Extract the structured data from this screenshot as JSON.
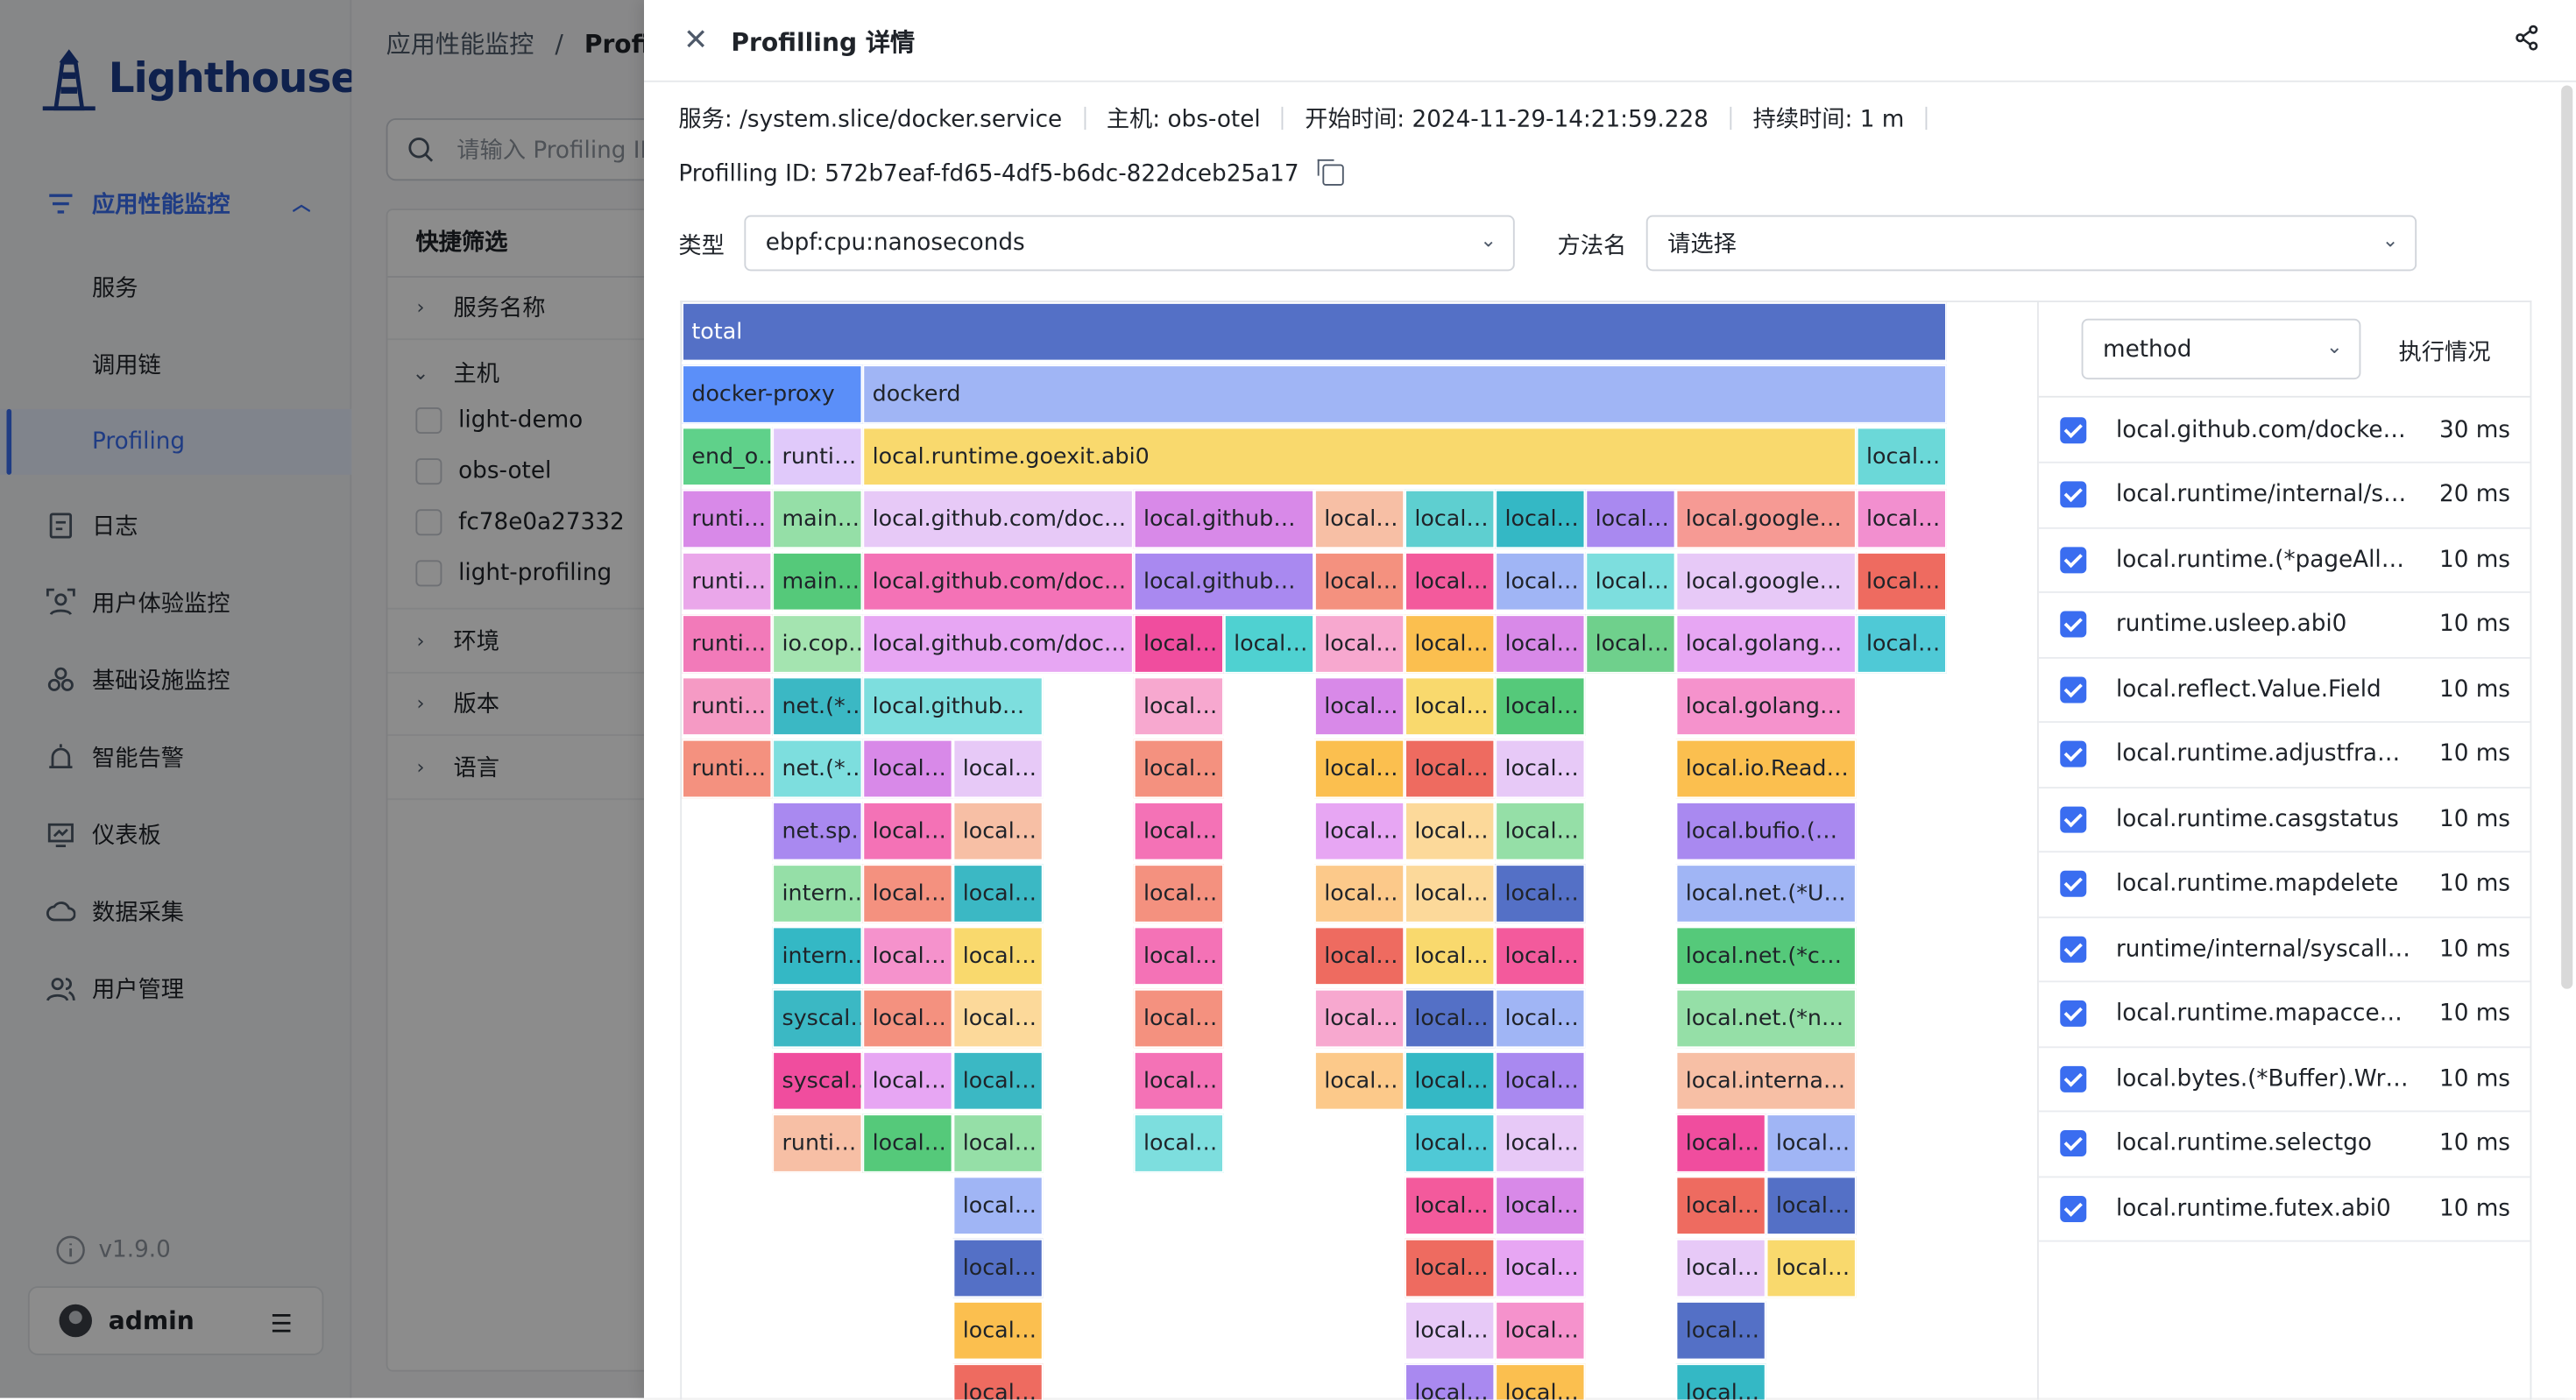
{
  "sidebar": {
    "brand": "Lighthouse",
    "nav": [
      {
        "label": "应用性能监控",
        "icon": "apm-icon"
      },
      {
        "label": "服务"
      },
      {
        "label": "调用链"
      },
      {
        "label": "Profiling"
      },
      {
        "label": "日志",
        "icon": "log-icon"
      },
      {
        "label": "用户体验监控",
        "icon": "user-exp-icon"
      },
      {
        "label": "基础设施监控",
        "icon": "infra-icon"
      },
      {
        "label": "智能告警",
        "icon": "alert-icon"
      },
      {
        "label": "仪表板",
        "icon": "dashboard-icon"
      },
      {
        "label": "数据采集",
        "icon": "collect-icon"
      },
      {
        "label": "用户管理",
        "icon": "user-mgmt-icon"
      }
    ],
    "version": "v1.9.0",
    "user": "admin"
  },
  "main": {
    "breadcrumb_root": "应用性能监控",
    "breadcrumb_sep": "/",
    "breadcrumb_current": "Profilin",
    "search_placeholder": "请输入 Profiling ID",
    "filter_title": "快捷筛选",
    "filters": [
      "服务名称",
      "主机",
      "环境",
      "版本",
      "语言"
    ],
    "host_options": [
      "light-demo",
      "obs-otel",
      "fc78e0a27332",
      "light-profiling"
    ]
  },
  "drawer": {
    "title": "Profilling 详情",
    "service": "服务: /system.slice/docker.service",
    "host": "主机: obs-otel",
    "start": "开始时间: 2024-11-29-14:21:59.228",
    "duration": "持续时间: 1 m",
    "profiling_id": "Profilling ID: 572b7eaf-fd65-4df5-b6dc-822dceb25a17",
    "type_label": "类型",
    "type_value": "ebpf:cpu:nanoseconds",
    "method_label": "方法名",
    "method_placeholder": "请选择",
    "group_by": "method",
    "exec_label": "执行情况"
  },
  "flame": [
    {
      "t": "total",
      "r": 0,
      "c": 0,
      "w": 14,
      "color": "#5470c6"
    },
    {
      "t": "docker-proxy",
      "r": 1,
      "c": 0,
      "w": 2,
      "color": "#5b8ff9"
    },
    {
      "t": "dockerd",
      "r": 1,
      "c": 2,
      "w": 12,
      "color": "#a0b5f5"
    },
    {
      "t": "end_o…",
      "r": 2,
      "c": 0,
      "w": 1,
      "color": "#5fd18a"
    },
    {
      "t": "runti…",
      "r": 2,
      "c": 1,
      "w": 1,
      "color": "#e0c9fa"
    },
    {
      "t": "local.runtime.goexit.abi0",
      "r": 2,
      "c": 2,
      "w": 11,
      "color": "#f9d96d"
    },
    {
      "t": "local…",
      "r": 2,
      "c": 13,
      "w": 1,
      "color": "#6bd8d8"
    },
    {
      "t": "runti…",
      "r": 3,
      "c": 0,
      "w": 1,
      "color": "#d889e8"
    },
    {
      "t": "main…",
      "r": 3,
      "c": 1,
      "w": 1,
      "color": "#95dfa7"
    },
    {
      "t": "local.github.com/doc…",
      "r": 3,
      "c": 2,
      "w": 3,
      "color": "#e7c9f7"
    },
    {
      "t": "local.github…",
      "r": 3,
      "c": 5,
      "w": 2,
      "color": "#d889e8"
    },
    {
      "t": "local…",
      "r": 3,
      "c": 7,
      "w": 1,
      "color": "#f7bfa5"
    },
    {
      "t": "local…",
      "r": 3,
      "c": 8,
      "w": 1,
      "color": "#5ecfd0"
    },
    {
      "t": "local…",
      "r": 3,
      "c": 9,
      "w": 1,
      "color": "#34b8c5"
    },
    {
      "t": "local…",
      "r": 3,
      "c": 10,
      "w": 1,
      "color": "#a989f0"
    },
    {
      "t": "local.google…",
      "r": 3,
      "c": 11,
      "w": 2,
      "color": "#f69a94"
    },
    {
      "t": "local…",
      "r": 3,
      "c": 13,
      "w": 1,
      "color": "#f28fcf"
    },
    {
      "t": "runti…",
      "r": 4,
      "c": 0,
      "w": 1,
      "color": "#eaa7ea"
    },
    {
      "t": "main…",
      "r": 4,
      "c": 1,
      "w": 1,
      "color": "#55c97a"
    },
    {
      "t": "local.github.com/doc…",
      "r": 4,
      "c": 2,
      "w": 3,
      "color": "#f472b6"
    },
    {
      "t": "local.github…",
      "r": 4,
      "c": 5,
      "w": 2,
      "color": "#a989f0"
    },
    {
      "t": "local…",
      "r": 4,
      "c": 7,
      "w": 1,
      "color": "#f4917f"
    },
    {
      "t": "local…",
      "r": 4,
      "c": 8,
      "w": 1,
      "color": "#f35a9c"
    },
    {
      "t": "local…",
      "r": 4,
      "c": 9,
      "w": 1,
      "color": "#a0b5f5"
    },
    {
      "t": "local…",
      "r": 4,
      "c": 10,
      "w": 1,
      "color": "#7ddede"
    },
    {
      "t": "local.google…",
      "r": 4,
      "c": 11,
      "w": 2,
      "color": "#e7c9f7"
    },
    {
      "t": "local…",
      "r": 4,
      "c": 13,
      "w": 1,
      "color": "#ee6b60"
    },
    {
      "t": "runti…",
      "r": 5,
      "c": 0,
      "w": 1,
      "color": "#f27ab9"
    },
    {
      "t": "io.cop…",
      "r": 5,
      "c": 1,
      "w": 1,
      "color": "#a4e4b0"
    },
    {
      "t": "local.github.com/doc…",
      "r": 5,
      "c": 2,
      "w": 3,
      "color": "#e7a6f3"
    },
    {
      "t": "local…",
      "r": 5,
      "c": 5,
      "w": 1,
      "color": "#f04d9e"
    },
    {
      "t": "local…",
      "r": 5,
      "c": 6,
      "w": 1,
      "color": "#4fd1d1"
    },
    {
      "t": "local…",
      "r": 5,
      "c": 7,
      "w": 1,
      "color": "#f7a8cf"
    },
    {
      "t": "local…",
      "r": 5,
      "c": 8,
      "w": 1,
      "color": "#fbbf4f"
    },
    {
      "t": "local…",
      "r": 5,
      "c": 9,
      "w": 1,
      "color": "#d889e8"
    },
    {
      "t": "local…",
      "r": 5,
      "c": 10,
      "w": 1,
      "color": "#6fd08c"
    },
    {
      "t": "local.golang…",
      "r": 5,
      "c": 11,
      "w": 2,
      "color": "#e7a6f3"
    },
    {
      "t": "local…",
      "r": 5,
      "c": 13,
      "w": 1,
      "color": "#4fc9d6"
    },
    {
      "t": "runti…",
      "r": 6,
      "c": 0,
      "w": 1,
      "color": "#f59ac4"
    },
    {
      "t": "net.(*…",
      "r": 6,
      "c": 1,
      "w": 1,
      "color": "#3bb8c4"
    },
    {
      "t": "local.github…",
      "r": 6,
      "c": 2,
      "w": 2,
      "color": "#7ddede"
    },
    {
      "t": "local…",
      "r": 6,
      "c": 5,
      "w": 1,
      "color": "#f7a8cf"
    },
    {
      "t": "local…",
      "r": 6,
      "c": 7,
      "w": 1,
      "color": "#d889e8"
    },
    {
      "t": "local…",
      "r": 6,
      "c": 8,
      "w": 1,
      "color": "#f9d96d"
    },
    {
      "t": "local…",
      "r": 6,
      "c": 9,
      "w": 1,
      "color": "#55c97a"
    },
    {
      "t": "local.golang…",
      "r": 6,
      "c": 11,
      "w": 2,
      "color": "#f592cc"
    },
    {
      "t": "runti…",
      "r": 7,
      "c": 0,
      "w": 1,
      "color": "#f4917f"
    },
    {
      "t": "net.(*…",
      "r": 7,
      "c": 1,
      "w": 1,
      "color": "#7ddede"
    },
    {
      "t": "local…",
      "r": 7,
      "c": 2,
      "w": 1,
      "color": "#d889e8"
    },
    {
      "t": "local…",
      "r": 7,
      "c": 3,
      "w": 1,
      "color": "#e7c9f7"
    },
    {
      "t": "local…",
      "r": 7,
      "c": 5,
      "w": 1,
      "color": "#f4917f"
    },
    {
      "t": "local…",
      "r": 7,
      "c": 7,
      "w": 1,
      "color": "#fbbf4f"
    },
    {
      "t": "local…",
      "r": 7,
      "c": 8,
      "w": 1,
      "color": "#ee6b60"
    },
    {
      "t": "local…",
      "r": 7,
      "c": 9,
      "w": 1,
      "color": "#e7c9f7"
    },
    {
      "t": "local.io.Read…",
      "r": 7,
      "c": 11,
      "w": 2,
      "color": "#fbbf4f"
    },
    {
      "t": "net.sp…",
      "r": 8,
      "c": 1,
      "w": 1,
      "color": "#a989f0"
    },
    {
      "t": "local…",
      "r": 8,
      "c": 2,
      "w": 1,
      "color": "#f472b6"
    },
    {
      "t": "local…",
      "r": 8,
      "c": 3,
      "w": 1,
      "color": "#f7bfa5"
    },
    {
      "t": "local…",
      "r": 8,
      "c": 5,
      "w": 1,
      "color": "#f472b6"
    },
    {
      "t": "local…",
      "r": 8,
      "c": 7,
      "w": 1,
      "color": "#e7a6f3"
    },
    {
      "t": "local…",
      "r": 8,
      "c": 8,
      "w": 1,
      "color": "#fcd99a"
    },
    {
      "t": "local…",
      "r": 8,
      "c": 9,
      "w": 1,
      "color": "#95dfa7"
    },
    {
      "t": "local.bufio.(…",
      "r": 8,
      "c": 11,
      "w": 2,
      "color": "#a989f0"
    },
    {
      "t": "intern…",
      "r": 9,
      "c": 1,
      "w": 1,
      "color": "#95dfa7"
    },
    {
      "t": "local…",
      "r": 9,
      "c": 2,
      "w": 1,
      "color": "#f4917f"
    },
    {
      "t": "local…",
      "r": 9,
      "c": 3,
      "w": 1,
      "color": "#3bb8c4"
    },
    {
      "t": "local…",
      "r": 9,
      "c": 5,
      "w": 1,
      "color": "#f4917f"
    },
    {
      "t": "local…",
      "r": 9,
      "c": 7,
      "w": 1,
      "color": "#fcc98a"
    },
    {
      "t": "local…",
      "r": 9,
      "c": 8,
      "w": 1,
      "color": "#fcd99a"
    },
    {
      "t": "local…",
      "r": 9,
      "c": 9,
      "w": 1,
      "color": "#5470c6"
    },
    {
      "t": "local.net.(*U…",
      "r": 9,
      "c": 11,
      "w": 2,
      "color": "#a0b5f5"
    },
    {
      "t": "intern…",
      "r": 10,
      "c": 1,
      "w": 1,
      "color": "#34b8c5"
    },
    {
      "t": "local…",
      "r": 10,
      "c": 2,
      "w": 1,
      "color": "#f592cc"
    },
    {
      "t": "local…",
      "r": 10,
      "c": 3,
      "w": 1,
      "color": "#f9d96d"
    },
    {
      "t": "local…",
      "r": 10,
      "c": 5,
      "w": 1,
      "color": "#f472b6"
    },
    {
      "t": "local…",
      "r": 10,
      "c": 7,
      "w": 1,
      "color": "#ee6b60"
    },
    {
      "t": "local…",
      "r": 10,
      "c": 8,
      "w": 1,
      "color": "#f9d96d"
    },
    {
      "t": "local…",
      "r": 10,
      "c": 9,
      "w": 1,
      "color": "#f35a9c"
    },
    {
      "t": "local.net.(*c…",
      "r": 10,
      "c": 11,
      "w": 2,
      "color": "#55c97a"
    },
    {
      "t": "syscal…",
      "r": 11,
      "c": 1,
      "w": 1,
      "color": "#3bb8c4"
    },
    {
      "t": "local…",
      "r": 11,
      "c": 2,
      "w": 1,
      "color": "#f4917f"
    },
    {
      "t": "local…",
      "r": 11,
      "c": 3,
      "w": 1,
      "color": "#fcd99a"
    },
    {
      "t": "local…",
      "r": 11,
      "c": 5,
      "w": 1,
      "color": "#f4917f"
    },
    {
      "t": "local…",
      "r": 11,
      "c": 7,
      "w": 1,
      "color": "#f7a8cf"
    },
    {
      "t": "local…",
      "r": 11,
      "c": 8,
      "w": 1,
      "color": "#5470c6"
    },
    {
      "t": "local…",
      "r": 11,
      "c": 9,
      "w": 1,
      "color": "#a0b5f5"
    },
    {
      "t": "local.net.(*n…",
      "r": 11,
      "c": 11,
      "w": 2,
      "color": "#95dfa7"
    },
    {
      "t": "syscal…",
      "r": 12,
      "c": 1,
      "w": 1,
      "color": "#f04d9e"
    },
    {
      "t": "local…",
      "r": 12,
      "c": 2,
      "w": 1,
      "color": "#e7a6f3"
    },
    {
      "t": "local…",
      "r": 12,
      "c": 3,
      "w": 1,
      "color": "#3bb8c4"
    },
    {
      "t": "local…",
      "r": 12,
      "c": 5,
      "w": 1,
      "color": "#f472b6"
    },
    {
      "t": "local…",
      "r": 12,
      "c": 7,
      "w": 1,
      "color": "#fcc98a"
    },
    {
      "t": "local…",
      "r": 12,
      "c": 8,
      "w": 1,
      "color": "#34b8c5"
    },
    {
      "t": "local…",
      "r": 12,
      "c": 9,
      "w": 1,
      "color": "#a989f0"
    },
    {
      "t": "local.interna…",
      "r": 12,
      "c": 11,
      "w": 2,
      "color": "#f7bfa5"
    },
    {
      "t": "runti…",
      "r": 13,
      "c": 1,
      "w": 1,
      "color": "#f7bfa5"
    },
    {
      "t": "local…",
      "r": 13,
      "c": 2,
      "w": 1,
      "color": "#55c97a"
    },
    {
      "t": "local…",
      "r": 13,
      "c": 3,
      "w": 1,
      "color": "#95dfa7"
    },
    {
      "t": "local…",
      "r": 13,
      "c": 5,
      "w": 1,
      "color": "#7ddede"
    },
    {
      "t": "local…",
      "r": 13,
      "c": 8,
      "w": 1,
      "color": "#4fc9d6"
    },
    {
      "t": "local…",
      "r": 13,
      "c": 9,
      "w": 1,
      "color": "#e7c9f7"
    },
    {
      "t": "local…",
      "r": 13,
      "c": 11,
      "w": 1,
      "color": "#f04d9e"
    },
    {
      "t": "local…",
      "r": 13,
      "c": 12,
      "w": 1,
      "color": "#a0b5f5"
    },
    {
      "t": "local…",
      "r": 14,
      "c": 3,
      "w": 1,
      "color": "#a0b5f5"
    },
    {
      "t": "local…",
      "r": 14,
      "c": 8,
      "w": 1,
      "color": "#f35a9c"
    },
    {
      "t": "local…",
      "r": 14,
      "c": 9,
      "w": 1,
      "color": "#d889e8"
    },
    {
      "t": "local…",
      "r": 14,
      "c": 11,
      "w": 1,
      "color": "#ee6b60"
    },
    {
      "t": "local…",
      "r": 14,
      "c": 12,
      "w": 1,
      "color": "#5470c6"
    },
    {
      "t": "local…",
      "r": 15,
      "c": 3,
      "w": 1,
      "color": "#5470c6"
    },
    {
      "t": "local…",
      "r": 15,
      "c": 8,
      "w": 1,
      "color": "#ee6b60"
    },
    {
      "t": "local…",
      "r": 15,
      "c": 9,
      "w": 1,
      "color": "#e7a6f3"
    },
    {
      "t": "local…",
      "r": 15,
      "c": 11,
      "w": 1,
      "color": "#e7c9f7"
    },
    {
      "t": "local…",
      "r": 15,
      "c": 12,
      "w": 1,
      "color": "#f9d96d"
    },
    {
      "t": "local…",
      "r": 16,
      "c": 3,
      "w": 1,
      "color": "#fbbf4f"
    },
    {
      "t": "local…",
      "r": 16,
      "c": 8,
      "w": 1,
      "color": "#e7c9f7"
    },
    {
      "t": "local…",
      "r": 16,
      "c": 9,
      "w": 1,
      "color": "#f592cc"
    },
    {
      "t": "local…",
      "r": 16,
      "c": 11,
      "w": 1,
      "color": "#5470c6"
    },
    {
      "t": "local…",
      "r": 17,
      "c": 3,
      "w": 1,
      "color": "#ee6b60"
    },
    {
      "t": "local…",
      "r": 17,
      "c": 8,
      "w": 1,
      "color": "#a989f0"
    },
    {
      "t": "local…",
      "r": 17,
      "c": 9,
      "w": 1,
      "color": "#fbbf4f"
    },
    {
      "t": "local…",
      "r": 17,
      "c": 11,
      "w": 1,
      "color": "#34b8c5"
    }
  ],
  "methods": [
    {
      "name": "local.github.com/docker…",
      "value": "30 ms"
    },
    {
      "name": "local.runtime/internal/sy…",
      "value": "20 ms"
    },
    {
      "name": "local.runtime.(*pageAllo…",
      "value": "10 ms"
    },
    {
      "name": "runtime.usleep.abi0",
      "value": "10 ms"
    },
    {
      "name": "local.reflect.Value.Field",
      "value": "10 ms"
    },
    {
      "name": "local.runtime.adjustframe",
      "value": "10 ms"
    },
    {
      "name": "local.runtime.casgstatus",
      "value": "10 ms"
    },
    {
      "name": "local.runtime.mapdelete",
      "value": "10 ms"
    },
    {
      "name": "runtime/internal/syscall.…",
      "value": "10 ms"
    },
    {
      "name": "local.runtime.mapaccess…",
      "value": "10 ms"
    },
    {
      "name": "local.bytes.(*Buffer).Write",
      "value": "10 ms"
    },
    {
      "name": "local.runtime.selectgo",
      "value": "10 ms"
    },
    {
      "name": "local.runtime.futex.abi0",
      "value": "10 ms"
    }
  ]
}
